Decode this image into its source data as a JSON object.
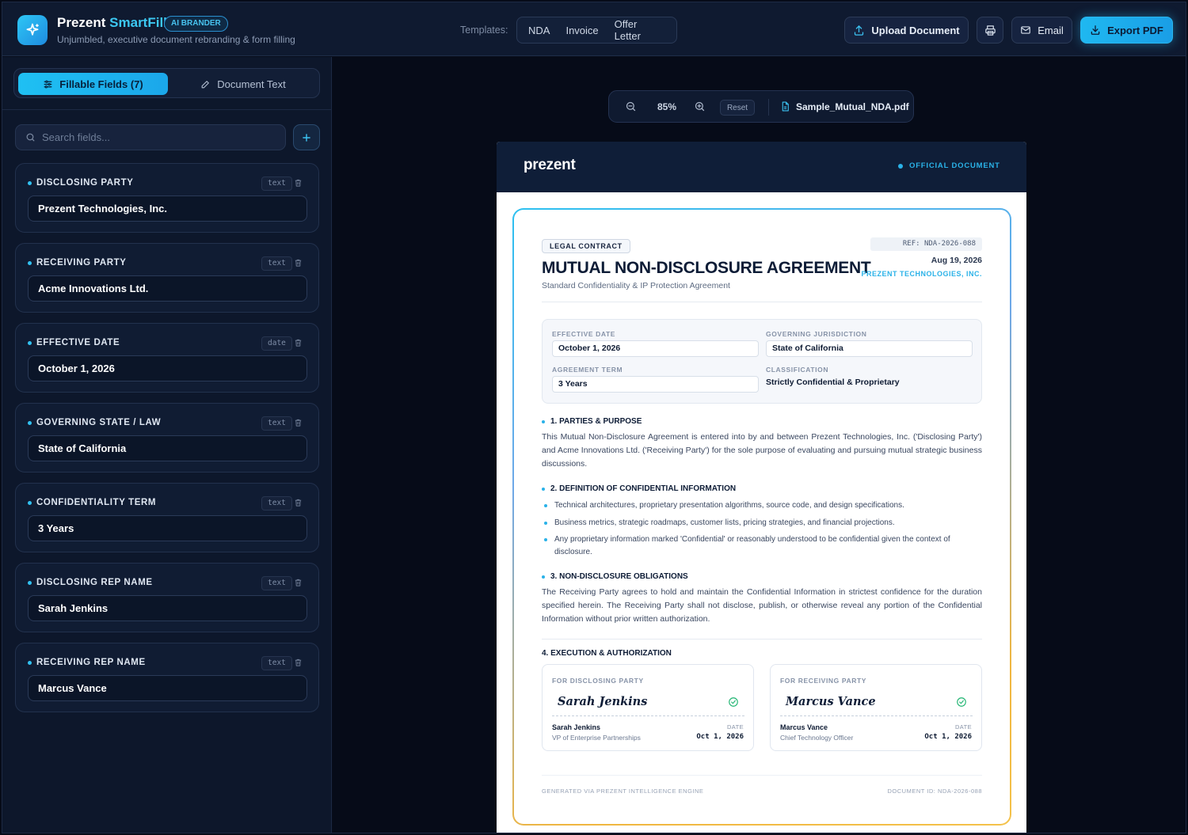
{
  "app": {
    "title_main": "Prezent",
    "title_accent": "SmartFill",
    "badge": "AI BRANDER",
    "subtitle": "Unjumbled, executive document rebranding & form filling"
  },
  "header": {
    "templates_label": "Templates:",
    "templates": [
      "NDA",
      "Invoice",
      "Offer Letter"
    ],
    "upload_label": "Upload Document",
    "email_label": "Email",
    "export_label": "Export PDF"
  },
  "sidebar": {
    "tab_fields": "Fillable Fields (7)",
    "tab_text": "Document Text",
    "search_placeholder": "Search fields...",
    "fields": [
      {
        "label": "DISCLOSING PARTY",
        "type": "text",
        "value": "Prezent Technologies, Inc."
      },
      {
        "label": "RECEIVING PARTY",
        "type": "text",
        "value": "Acme Innovations Ltd."
      },
      {
        "label": "EFFECTIVE DATE",
        "type": "date",
        "value": "October 1, 2026"
      },
      {
        "label": "GOVERNING STATE / LAW",
        "type": "text",
        "value": "State of California"
      },
      {
        "label": "CONFIDENTIALITY TERM",
        "type": "text",
        "value": "3 Years"
      },
      {
        "label": "DISCLOSING REP NAME",
        "type": "text",
        "value": "Sarah Jenkins"
      },
      {
        "label": "RECEIVING REP NAME",
        "type": "text",
        "value": "Marcus Vance"
      }
    ]
  },
  "viewer": {
    "zoom": "85%",
    "reset_label": "Reset",
    "file_name": "Sample_Mutual_NDA.pdf"
  },
  "document": {
    "brand": "prezent",
    "official_label": "OFFICIAL DOCUMENT",
    "tag": "LEGAL CONTRACT",
    "title": "MUTUAL NON-DISCLOSURE AGREEMENT",
    "subtitle": "Standard Confidentiality & IP Protection Agreement",
    "ref": "REF: NDA-2026-088",
    "date": "Aug 19, 2026",
    "company": "PREZENT TECHNOLOGIES, INC.",
    "meta": {
      "effective_date_label": "EFFECTIVE DATE",
      "effective_date": "October 1, 2026",
      "jurisdiction_label": "GOVERNING JURISDICTION",
      "jurisdiction": "State of California",
      "term_label": "AGREEMENT TERM",
      "term": "3 Years",
      "classification_label": "CLASSIFICATION",
      "classification": "Strictly Confidential & Proprietary"
    },
    "section1_head": "1. PARTIES & PURPOSE",
    "section1_body": "This Mutual Non-Disclosure Agreement is entered into by and between Prezent Technologies, Inc. ('Disclosing Party') and Acme Innovations Ltd. ('Receiving Party') for the sole purpose of evaluating and pursuing mutual strategic business discussions.",
    "section2_head": "2. DEFINITION OF CONFIDENTIAL INFORMATION",
    "section2_bullets": [
      "Technical architectures, proprietary presentation algorithms, source code, and design specifications.",
      "Business metrics, strategic roadmaps, customer lists, pricing strategies, and financial projections.",
      "Any proprietary information marked 'Confidential' or reasonably understood to be confidential given the context of disclosure."
    ],
    "section3_head": "3. NON-DISCLOSURE OBLIGATIONS",
    "section3_body": "The Receiving Party agrees to hold and maintain the Confidential Information in strictest confidence for the duration specified herein. The Receiving Party shall not disclose, publish, or otherwise reveal any portion of the Confidential Information without prior written authorization.",
    "section4_head": "4. EXECUTION & AUTHORIZATION",
    "signatures": [
      {
        "for": "FOR DISCLOSING PARTY",
        "script": "Sarah Jenkins",
        "name": "Sarah Jenkins",
        "role": "VP of Enterprise Partnerships",
        "date_label": "DATE",
        "date": "Oct 1, 2026"
      },
      {
        "for": "FOR RECEIVING PARTY",
        "script": "Marcus Vance",
        "name": "Marcus Vance",
        "role": "Chief Technology Officer",
        "date_label": "DATE",
        "date": "Oct 1, 2026"
      }
    ],
    "footer_left": "GENERATED VIA PREZENT INTELLIGENCE ENGINE",
    "footer_right": "DOCUMENT ID: NDA-2026-088"
  }
}
